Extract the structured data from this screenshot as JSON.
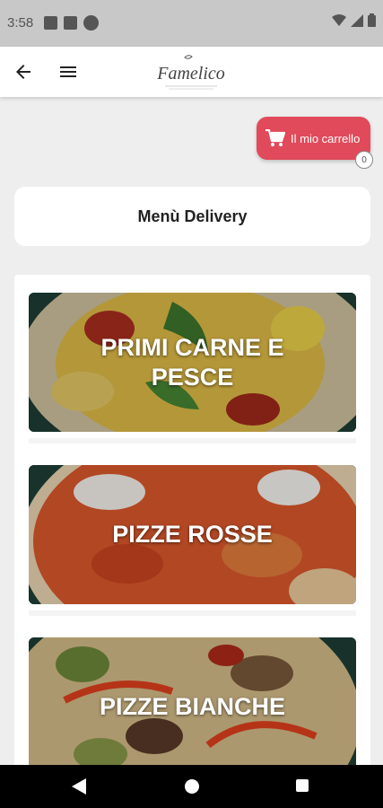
{
  "status_bar": {
    "time": "3:58"
  },
  "header": {
    "logo_text": "Famelico"
  },
  "cart": {
    "label": "Il mio carrello",
    "count": "0",
    "accent": "#e04a5a"
  },
  "menu": {
    "title": "Menù Delivery",
    "categories": [
      {
        "name": "PRIMI CARNE E PESCE"
      },
      {
        "name": "PIZZE ROSSE"
      },
      {
        "name": "PIZZE BIANCHE"
      }
    ]
  }
}
